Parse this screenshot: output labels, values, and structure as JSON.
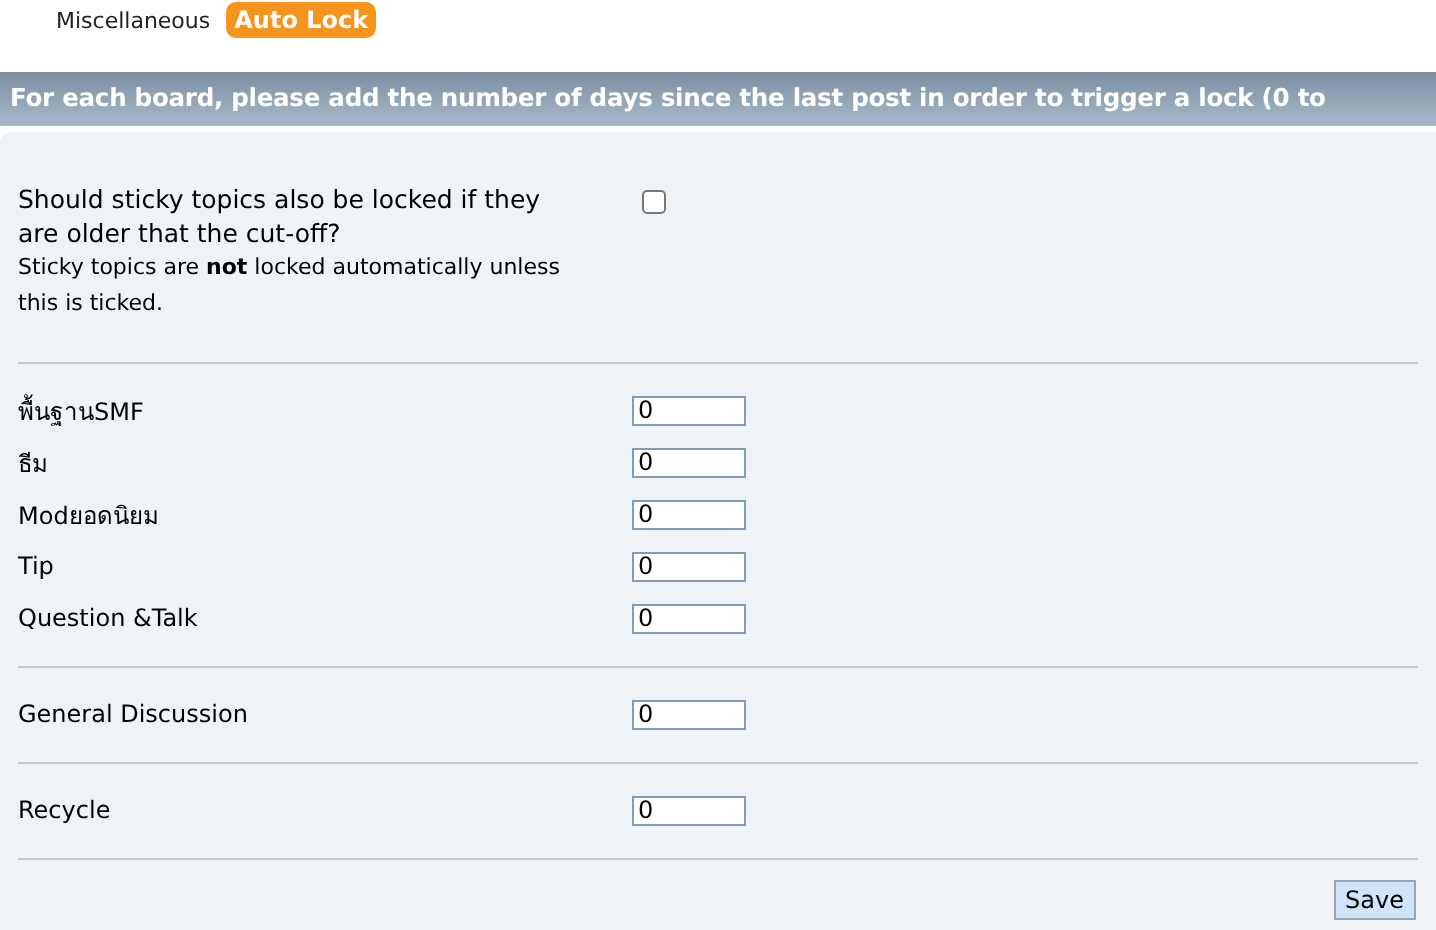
{
  "tabs": [
    {
      "label": "Miscellaneous",
      "selected": false
    },
    {
      "label": "Auto Lock",
      "selected": true
    }
  ],
  "header": "For each board, please add the number of days since the last post in order to trigger a lock (0 to",
  "sticky": {
    "label": "Should sticky topics also be locked if they are older that the cut-off?",
    "note": "Sticky topics are **not** locked automatically unless this is ticked.",
    "checked": false
  },
  "board_groups": [
    [
      {
        "name": "พื้นฐานSMF",
        "value": "0"
      },
      {
        "name": "ธีม",
        "value": "0"
      },
      {
        "name": "Modยอดนิยม",
        "value": "0"
      },
      {
        "name": "Tip",
        "value": "0"
      },
      {
        "name": "Question &Talk",
        "value": "0"
      }
    ],
    [
      {
        "name": "General Discussion",
        "value": "0"
      }
    ],
    [
      {
        "name": "Recycle",
        "value": "0"
      }
    ]
  ],
  "save_button": "Save"
}
